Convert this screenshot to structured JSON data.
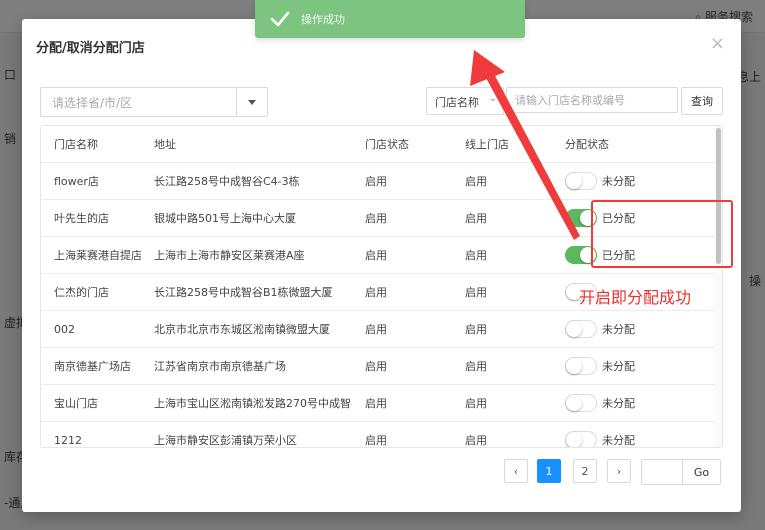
{
  "background": {
    "search_label": "服务搜索",
    "left_fragments": [
      "口",
      "销",
      "虚拟",
      "库存",
      "-通用"
    ],
    "right_fragments": [
      "信息上",
      "操"
    ]
  },
  "toast": {
    "message": "操作成功"
  },
  "modal": {
    "title": "分配/取消分配门店",
    "close_symbol": "×",
    "region_select_placeholder": "请选择省/市/区",
    "field_select_value": "门店名称",
    "search_placeholder": "请输入门店名称或编号",
    "query_button": "查询"
  },
  "table": {
    "columns": [
      "门店名称",
      "地址",
      "门店状态",
      "线上门店",
      "分配状态"
    ],
    "rows": [
      {
        "name": "flower店",
        "address": "长江路258号中成智谷C4-3栋",
        "store_status": "启用",
        "online": "启用",
        "assigned": false,
        "assign_label": "未分配"
      },
      {
        "name": "叶先生的店",
        "address": "银城中路501号上海中心大厦",
        "store_status": "启用",
        "online": "启用",
        "assigned": true,
        "assign_label": "已分配"
      },
      {
        "name": "上海莱赛港自提店",
        "address": "上海市上海市静安区莱赛港A座",
        "store_status": "启用",
        "online": "启用",
        "assigned": true,
        "assign_label": "已分配"
      },
      {
        "name": "仁杰的门店",
        "address": "长江路258号中成智谷B1栋微盟大厦",
        "store_status": "启用",
        "online": "启用",
        "assigned": false,
        "assign_label": ""
      },
      {
        "name": "002",
        "address": "北京市北京市东城区淞南镇微盟大厦",
        "store_status": "启用",
        "online": "启用",
        "assigned": false,
        "assign_label": "未分配"
      },
      {
        "name": "南京德基广场店",
        "address": "江苏省南京市南京德基广场",
        "store_status": "启用",
        "online": "启用",
        "assigned": false,
        "assign_label": "未分配"
      },
      {
        "name": "宝山门店",
        "address": "上海市宝山区淞南镇淞发路270号中成智谷",
        "store_status": "启用",
        "online": "启用",
        "assigned": false,
        "assign_label": "未分配"
      },
      {
        "name": "1212",
        "address": "上海市静安区彭浦镇万荣小区",
        "store_status": "启用",
        "online": "启用",
        "assigned": false,
        "assign_label": "未分配"
      }
    ]
  },
  "pagination": {
    "prev": "‹",
    "pages": [
      "1",
      "2"
    ],
    "current_page": "1",
    "next": "›",
    "go_label": "Go"
  },
  "annotation": {
    "text": "开启即分配成功",
    "color": "#e8322e"
  }
}
